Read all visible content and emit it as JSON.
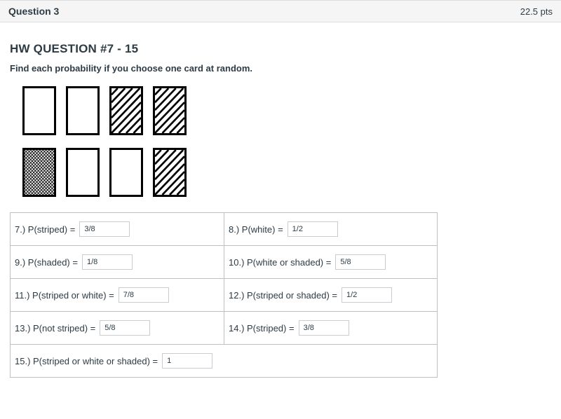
{
  "header": {
    "question": "Question 3",
    "points": "22.5 pts"
  },
  "title": "HW QUESTION #7 - 15",
  "instruction": "Find each probability if you choose one card at random.",
  "cards": {
    "row1": [
      "white",
      "white",
      "striped",
      "striped"
    ],
    "row2": [
      "shaded",
      "white",
      "white",
      "striped"
    ]
  },
  "answers": {
    "q7": {
      "label": "7.)   P(striped) = ",
      "value": "3/8"
    },
    "q8": {
      "label": "8.)   P(white) = ",
      "value": "1/2"
    },
    "q9": {
      "label": "9.)   P(shaded) = ",
      "value": "1/8"
    },
    "q10": {
      "label": "10.)   P(white or shaded) = ",
      "value": "5/8"
    },
    "q11": {
      "label": "11.)   P(striped or white) = ",
      "value": "7/8"
    },
    "q12": {
      "label": "12.)   P(striped or shaded) = ",
      "value": "1/2"
    },
    "q13": {
      "label": "13.)   P(not striped) = ",
      "value": "5/8"
    },
    "q14": {
      "label": "14.)   P(striped) = ",
      "value": "3/8"
    },
    "q15": {
      "label": "15.)   P(striped or white or shaded) = ",
      "value": "1"
    }
  }
}
